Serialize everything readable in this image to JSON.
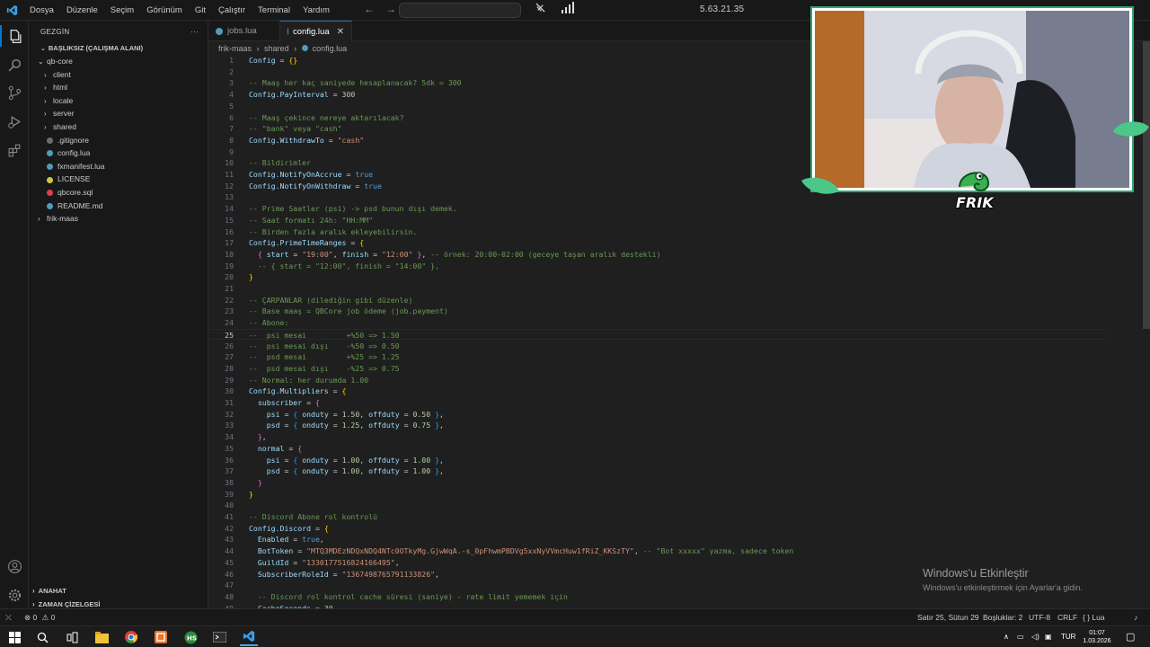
{
  "titlebar": {
    "menu": [
      "Dosya",
      "Düzenle",
      "Seçim",
      "Görünüm",
      "Git",
      "Çalıştır",
      "Terminal",
      "Yardım"
    ],
    "center_text": "5.63.21.35"
  },
  "sidebar": {
    "header": "GEZGİN",
    "header_more": "···",
    "workspace_title": "BAŞLIKSIZ (ÇALIŞMA ALANI)",
    "tree": [
      {
        "label": "qb-core",
        "type": "folder-open",
        "indent": 1
      },
      {
        "label": "client",
        "type": "folder",
        "indent": 2
      },
      {
        "label": "html",
        "type": "folder",
        "indent": 2
      },
      {
        "label": "locale",
        "type": "folder",
        "indent": 2
      },
      {
        "label": "server",
        "type": "folder",
        "indent": 2
      },
      {
        "label": "shared",
        "type": "folder",
        "indent": 2
      },
      {
        "label": ".gitignore",
        "type": "file-git",
        "indent": 2
      },
      {
        "label": "config.lua",
        "type": "file-lua",
        "indent": 2
      },
      {
        "label": "fxmanifest.lua",
        "type": "file-lua",
        "indent": 2
      },
      {
        "label": "LICENSE",
        "type": "file-license",
        "indent": 2
      },
      {
        "label": "qbcore.sql",
        "type": "file-sql",
        "indent": 2
      },
      {
        "label": "README.md",
        "type": "file-md",
        "indent": 2
      },
      {
        "label": "frik-maas",
        "type": "folder",
        "indent": 1
      }
    ],
    "outline": "ANAHAT",
    "timeline": "ZAMAN ÇİZELGESİ"
  },
  "tabs": [
    {
      "label": "jobs.lua",
      "active": false
    },
    {
      "label": "config.lua",
      "active": true
    }
  ],
  "breadcrumb": [
    "frik-maas",
    "shared",
    "config.lua"
  ],
  "breadcrumb_sep": "›",
  "code_lines": [
    {
      "n": "1",
      "html": "<span class='t-id'>Config</span> = <span class='t-br1'>{}</span>"
    },
    {
      "n": "2",
      "html": ""
    },
    {
      "n": "3",
      "html": "<span class='t-com'>-- Maaş her kaç saniyede hesaplanacak? 5dk = 300</span>"
    },
    {
      "n": "4",
      "html": "<span class='t-id'>Config</span>.<span class='t-field'>PayInterval</span> = <span class='t-num'>300</span>"
    },
    {
      "n": "5",
      "html": ""
    },
    {
      "n": "6",
      "html": "<span class='t-com'>-- Maaş çekince nereye aktarılacak?</span>"
    },
    {
      "n": "7",
      "html": "<span class='t-com'>-- \"bank\" veya \"cash\"</span>"
    },
    {
      "n": "8",
      "html": "<span class='t-id'>Config</span>.<span class='t-field'>WithdrawTo</span> = <span class='t-str'>\"cash\"</span>"
    },
    {
      "n": "9",
      "html": ""
    },
    {
      "n": "10",
      "html": "<span class='t-com'>-- Bildirimler</span>"
    },
    {
      "n": "11",
      "html": "<span class='t-id'>Config</span>.<span class='t-field'>NotifyOnAccrue</span> = <span class='t-kw'>true</span>"
    },
    {
      "n": "12",
      "html": "<span class='t-id'>Config</span>.<span class='t-field'>NotifyOnWithdraw</span> = <span class='t-kw'>true</span>"
    },
    {
      "n": "13",
      "html": ""
    },
    {
      "n": "14",
      "html": "<span class='t-com'>-- Prime Saatler (psi) -> psd bunun dışı demek.</span>"
    },
    {
      "n": "15",
      "html": "<span class='t-com'>-- Saat formatı 24h: \"HH:MM\"</span>"
    },
    {
      "n": "16",
      "html": "<span class='t-com'>-- Birden fazla aralık ekleyebilirsin.</span>"
    },
    {
      "n": "17",
      "html": "<span class='t-id'>Config</span>.<span class='t-field'>PrimeTimeRanges</span> = <span class='t-br1'>{</span>"
    },
    {
      "n": "18",
      "html": "  <span class='t-br2'>{</span> <span class='t-field'>start</span> = <span class='t-str'>\"19:00\"</span>, <span class='t-field'>finish</span> = <span class='t-str'>\"12:00\"</span> <span class='t-br2'>}</span>, <span class='t-com'>-- örnek: 20:00-02:00 (geceye taşan aralık destekli)</span>"
    },
    {
      "n": "19",
      "html": "  <span class='t-com'>-- { start = \"12:00\", finish = \"14:00\" },</span>"
    },
    {
      "n": "20",
      "html": "<span class='t-br1'>}</span>"
    },
    {
      "n": "21",
      "html": ""
    },
    {
      "n": "22",
      "html": "<span class='t-com'>-- ÇARPANLAR (dilediğin gibi düzenle)</span>"
    },
    {
      "n": "23",
      "html": "<span class='t-com'>-- Base maaş = QBCore job ödeme (job.payment)</span>"
    },
    {
      "n": "24",
      "html": "<span class='t-com'>-- Abone:</span>"
    },
    {
      "n": "25",
      "html": "<span class='t-com'>--  psi mesai         +%50 => 1.50</span>",
      "current": true
    },
    {
      "n": "26",
      "html": "<span class='t-com'>--  psi mesai dışı    -%50 => 0.50</span>"
    },
    {
      "n": "27",
      "html": "<span class='t-com'>--  psd mesai         +%25 => 1.25</span>"
    },
    {
      "n": "28",
      "html": "<span class='t-com'>--  psd mesai dışı    -%25 => 0.75</span>"
    },
    {
      "n": "29",
      "html": "<span class='t-com'>-- Normal: her durumda 1.00</span>"
    },
    {
      "n": "30",
      "html": "<span class='t-id'>Config</span>.<span class='t-field'>Multipliers</span> = <span class='t-br1'>{</span>"
    },
    {
      "n": "31",
      "html": "  <span class='t-field'>subscriber</span> = <span class='t-br2'>{</span>"
    },
    {
      "n": "32",
      "html": "    <span class='t-field'>psi</span> = <span class='t-br3'>{</span> <span class='t-field'>onduty</span> = <span class='t-num'>1.50</span>, <span class='t-field'>offduty</span> = <span class='t-num'>0.50</span> <span class='t-br3'>}</span>,"
    },
    {
      "n": "33",
      "html": "    <span class='t-field'>psd</span> = <span class='t-br3'>{</span> <span class='t-field'>onduty</span> = <span class='t-num'>1.25</span>, <span class='t-field'>offduty</span> = <span class='t-num'>0.75</span> <span class='t-br3'>}</span>,"
    },
    {
      "n": "34",
      "html": "  <span class='t-br2'>}</span>,"
    },
    {
      "n": "35",
      "html": "  <span class='t-field'>normal</span> = <span class='t-br2'>{</span>"
    },
    {
      "n": "36",
      "html": "    <span class='t-field'>psi</span> = <span class='t-br3'>{</span> <span class='t-field'>onduty</span> = <span class='t-num'>1.00</span>, <span class='t-field'>offduty</span> = <span class='t-num'>1.00</span> <span class='t-br3'>}</span>,"
    },
    {
      "n": "37",
      "html": "    <span class='t-field'>psd</span> = <span class='t-br3'>{</span> <span class='t-field'>onduty</span> = <span class='t-num'>1.00</span>, <span class='t-field'>offduty</span> = <span class='t-num'>1.00</span> <span class='t-br3'>}</span>,"
    },
    {
      "n": "38",
      "html": "  <span class='t-br2'>}</span>"
    },
    {
      "n": "39",
      "html": "<span class='t-br1'>}</span>"
    },
    {
      "n": "40",
      "html": ""
    },
    {
      "n": "41",
      "html": "<span class='t-com'>-- Discord Abone rol kontrolü</span>"
    },
    {
      "n": "42",
      "html": "<span class='t-id'>Config</span>.<span class='t-field'>Discord</span> = <span class='t-br1'>{</span>"
    },
    {
      "n": "43",
      "html": "  <span class='t-field'>Enabled</span> = <span class='t-kw'>true</span>,"
    },
    {
      "n": "44",
      "html": "  <span class='t-field'>BotToken</span> = <span class='t-str'>\"MTQ3MDEzNDQxNDQ4NTc0OTkyMg.GjwWqA.-s_0pFhwmPBDVg5xxNyVVmcHuw1fRiZ_KKSzTY\"</span>, <span class='t-com'>-- \"Bot xxxxx\" yazma, sadece token</span>"
    },
    {
      "n": "45",
      "html": "  <span class='t-field'>GuildId</span> = <span class='t-str'>\"1330177516824166495\"</span>,"
    },
    {
      "n": "46",
      "html": "  <span class='t-field'>SubscriberRoleId</span> = <span class='t-str'>\"1367498765791133826\"</span>,"
    },
    {
      "n": "47",
      "html": ""
    },
    {
      "n": "48",
      "html": "  <span class='t-com'>-- Discord rol kontrol cache süresi (saniye) - rate limit yememek için</span>"
    },
    {
      "n": "49",
      "html": "  <span class='t-field'>CacheSeconds</span> = <span class='t-num'>30</span>,"
    }
  ],
  "activation": {
    "title": "Windows'u Etkinleştir",
    "subtitle": "Windows'u etkinleştirmek için Ayarlar'a gidin."
  },
  "webcam": {
    "brand_text": "FRIK",
    "accent": "#2fa874"
  },
  "statusbar": {
    "errors": "0",
    "warnings": "0",
    "cursor": "Satır 25, Sütun 29",
    "indent": "Boşluklar: 2",
    "encoding": "UTF-8",
    "eol": "CRLF",
    "language": "Lua"
  },
  "taskbar": {
    "lang": "TUR",
    "time": "01:07",
    "date": "1.03.2026"
  },
  "colors": {
    "accent": "#0078d4",
    "background": "#1f1f1f",
    "sidebar": "#181818"
  }
}
